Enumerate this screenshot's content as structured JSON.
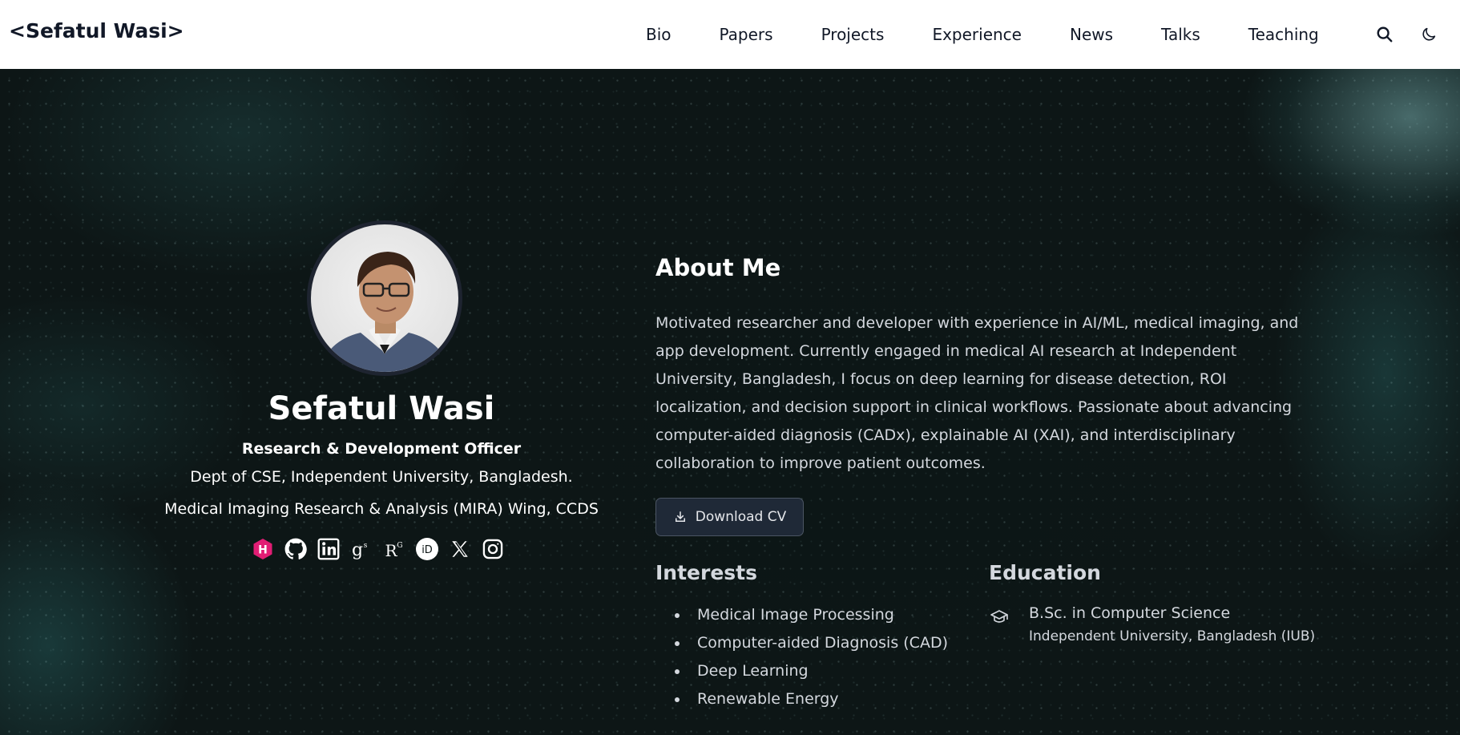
{
  "header": {
    "brand": "<Sefatul Wasi>",
    "nav": [
      "Bio",
      "Papers",
      "Projects",
      "Experience",
      "News",
      "Talks",
      "Teaching"
    ],
    "icons": [
      "search-icon",
      "moon-icon"
    ]
  },
  "profile": {
    "name": "Sefatul Wasi",
    "role": "Research & Development Officer",
    "org_line1": "Dept of CSE, Independent University, Bangladesh.",
    "org_line2": "Medical Imaging Research & Analysis (MIRA) Wing, CCDS",
    "socials": [
      "hashnode-icon",
      "github-icon",
      "linkedin-icon",
      "google-scholar-icon",
      "researchgate-icon",
      "orcid-icon",
      "x-icon",
      "instagram-icon"
    ],
    "researchgate_glyph": "R",
    "researchgate_sup": "G",
    "orcid_glyph": "iD"
  },
  "about": {
    "title": "About Me",
    "text": "Motivated researcher and developer with experience in AI/ML, medical imaging, and app development. Currently engaged in medical AI research at Independent University, Bangladesh, I focus on deep learning for disease detection, ROI localization, and decision support in clinical workflows. Passionate about advancing computer-aided diagnosis (CADx), explainable AI (XAI), and interdisciplinary collaboration to improve patient outcomes.",
    "cv_button": "Download CV"
  },
  "interests": {
    "title": "Interests",
    "items": [
      "Medical Image Processing",
      "Computer-aided Diagnosis (CAD)",
      "Deep Learning",
      "Renewable Energy"
    ]
  },
  "education": {
    "title": "Education",
    "degree": "B.Sc. in Computer Science",
    "school": "Independent University, Bangladesh (IUB)"
  },
  "colors": {
    "header_bg": "#ffffff",
    "hero_bg": "#0d1616",
    "text_primary": "#ffffff",
    "text_secondary": "#d4d8de",
    "button_bg": "#1f2937",
    "hashnode_pink": "#e11d74"
  }
}
